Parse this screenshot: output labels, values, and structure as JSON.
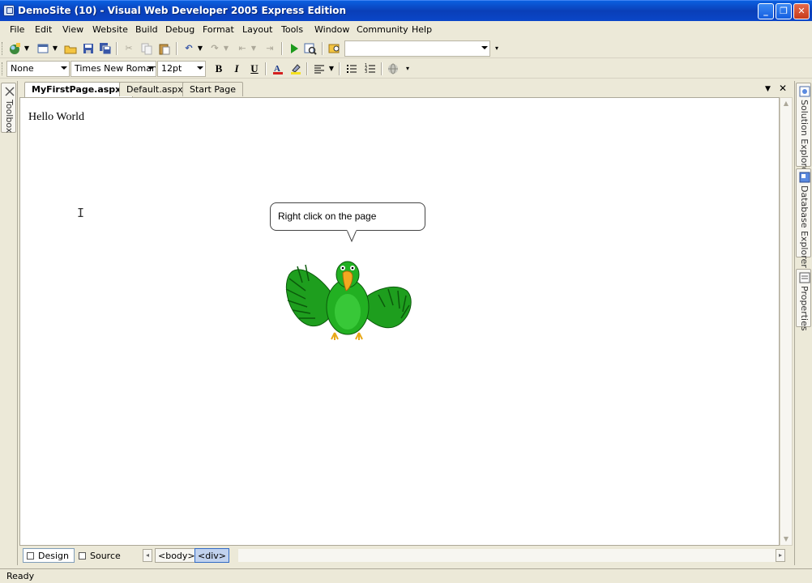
{
  "window": {
    "title": "DemoSite (10) - Visual Web Developer 2005 Express Edition",
    "buttons": [
      "minimize",
      "maximize",
      "close"
    ]
  },
  "menu": {
    "items": [
      "File",
      "Edit",
      "View",
      "Website",
      "Build",
      "Debug",
      "Format",
      "Layout",
      "Tools",
      "Window",
      "Community",
      "Help"
    ]
  },
  "format_toolbar": {
    "block_format": "None",
    "font_name": "Times New Roman",
    "font_size": "12pt",
    "bold": "B",
    "italic": "I",
    "underline": "U"
  },
  "left_panels": {
    "toolbox": "Toolbox"
  },
  "right_panels": {
    "solution_explorer": "Solution Explorer",
    "database_explorer": "Database Explorer",
    "properties": "Properties"
  },
  "tabs": [
    {
      "label": "MyFirstPage.aspx*",
      "active": true
    },
    {
      "label": "Default.aspx",
      "active": false
    },
    {
      "label": "Start Page",
      "active": false
    }
  ],
  "document": {
    "text": "Hello World",
    "bubble_text": "Right click on the page"
  },
  "view_switcher": {
    "design": "Design",
    "source": "Source",
    "crumbs": [
      "<body>",
      "<div>"
    ]
  },
  "status": {
    "text": "Ready"
  }
}
